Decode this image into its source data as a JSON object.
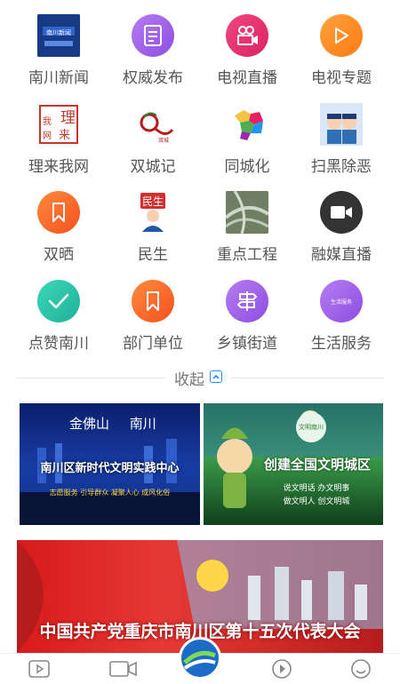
{
  "grid": [
    {
      "label": "南川新闻",
      "icon": "news-thumbnail-icon",
      "color": "#1b3f8c"
    },
    {
      "label": "权威发布",
      "icon": "document-icon",
      "color": "#9b5de5"
    },
    {
      "label": "电视直播",
      "icon": "tv-camera-icon",
      "color": "#e6336b"
    },
    {
      "label": "电视专题",
      "icon": "play-icon",
      "color": "#ff8a1f"
    },
    {
      "label": "理来我网",
      "icon": "seal-logo-icon",
      "color": "#c0392b"
    },
    {
      "label": "双城记",
      "icon": "double-city-logo-icon",
      "color": "#b71c1c"
    },
    {
      "label": "同城化",
      "icon": "city-map-icon",
      "color": "#e91e63"
    },
    {
      "label": "扫黑除恶",
      "icon": "police-cartoon-icon",
      "color": "#2f6fb5"
    },
    {
      "label": "双晒",
      "icon": "bookmark-icon",
      "color": "#ff6d2a"
    },
    {
      "label": "民生",
      "icon": "minsheng-figure-icon",
      "color": "#d32f2f"
    },
    {
      "label": "重点工程",
      "icon": "highway-photo-icon",
      "color": "#6b7c62"
    },
    {
      "label": "融媒直播",
      "icon": "video-camera-icon",
      "color": "#333333"
    },
    {
      "label": "点赞南川",
      "icon": "check-icon",
      "color": "#26c6a6"
    },
    {
      "label": "部门单位",
      "icon": "bookmark-icon",
      "color": "#ff6d2a"
    },
    {
      "label": "乡镇街道",
      "icon": "signpost-icon",
      "color": "#9b5de5"
    },
    {
      "label": "生活服务",
      "icon": "life-service-icon",
      "color": "#9b5de5",
      "badge": "生活服务"
    }
  ],
  "collapse": {
    "label": "收起"
  },
  "banners": {
    "left": {
      "title": "金佛山",
      "title2": "南川",
      "headline": "南川区新时代文明实践中心",
      "sub": "志愿服务 引导群众 凝聚人心 成风化俗"
    },
    "right": {
      "headline": "创建全国文明城区",
      "lines": [
        "说文明话 办文明事",
        "做文明人 创文明城"
      ],
      "badge": "文明南川"
    },
    "big": {
      "headline": "中国共产党重庆市南川区第十五次代表大会"
    }
  },
  "nav": [
    {
      "icon": "play-outline-icon"
    },
    {
      "icon": "video-outline-icon"
    },
    {
      "icon": "app-logo-icon"
    },
    {
      "icon": "replay-icon"
    },
    {
      "icon": "smile-icon"
    }
  ]
}
